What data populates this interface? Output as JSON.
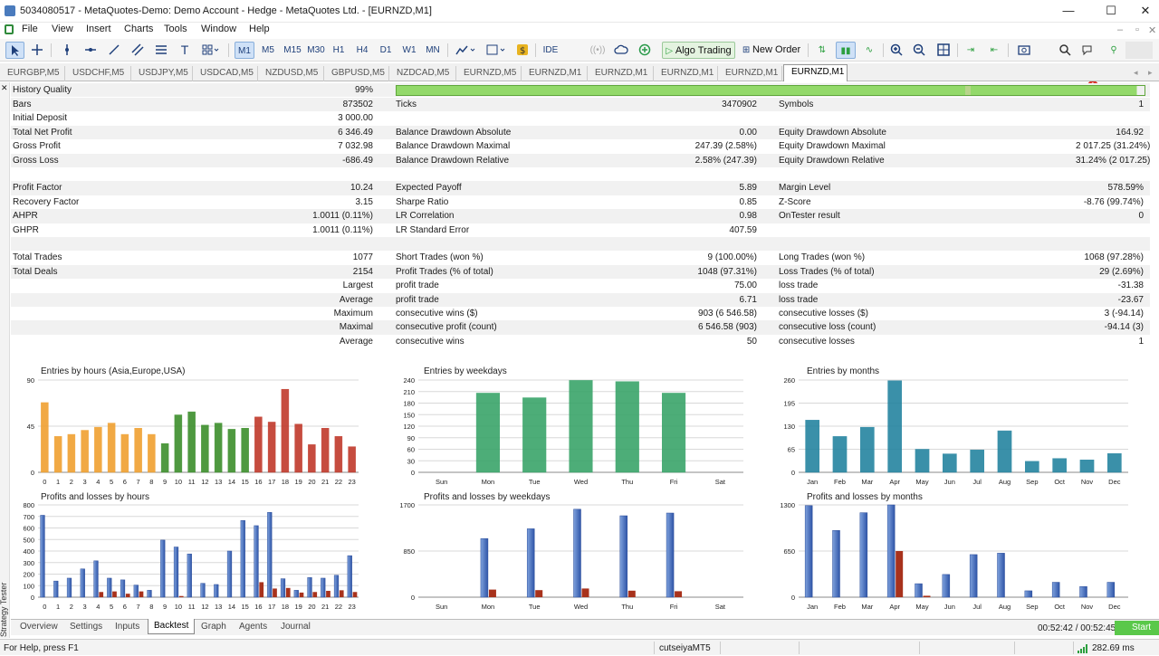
{
  "window": {
    "title": "5034080517 - MetaQuotes-Demo: Demo Account - Hedge - MetaQuotes Ltd. - [EURNZD,M1]",
    "minimize": "—",
    "maximize": "☐",
    "close": "✕"
  },
  "menu": [
    "File",
    "View",
    "Insert",
    "Charts",
    "Tools",
    "Window",
    "Help"
  ],
  "mdi_controls": [
    "–",
    "▫",
    "✕"
  ],
  "toolbar": {
    "timeframes": [
      "M1",
      "M5",
      "M15",
      "M30",
      "H1",
      "H4",
      "D1",
      "W1",
      "MN"
    ],
    "active_tf": "M1",
    "ide": "IDE",
    "algo_trading": "Algo Trading",
    "new_order": "New Order",
    "notification_badge": "1"
  },
  "chart_tabs": [
    "EURGBP,M5",
    "USDCHF,M5",
    "USDJPY,M5",
    "USDCAD,M5",
    "NZDUSD,M5",
    "GBPUSD,M5",
    "NZDCAD,M5",
    "EURNZD,M5",
    "EURNZD,M1",
    "EURNZD,M1",
    "EURNZD,M1",
    "EURNZD,M1",
    "EURNZD,M1"
  ],
  "tester_label": "Strategy Tester",
  "history_quality": {
    "label": "History Quality",
    "value": "99%",
    "fraction": 0.99
  },
  "stats": [
    {
      "l1": "Bars",
      "v1": "873502",
      "l2": "Ticks",
      "v2": "3470902",
      "l3": "Symbols",
      "v3": "1"
    },
    {
      "l1": "Initial Deposit",
      "v1": "3 000.00",
      "l2": "",
      "v2": "",
      "l3": "",
      "v3": ""
    },
    {
      "l1": "Total Net Profit",
      "v1": "6 346.49",
      "l2": "Balance Drawdown Absolute",
      "v2": "0.00",
      "l3": "Equity Drawdown Absolute",
      "v3": "164.92"
    },
    {
      "l1": "Gross Profit",
      "v1": "7 032.98",
      "l2": "Balance Drawdown Maximal",
      "v2": "247.39 (2.58%)",
      "l3": "Equity Drawdown Maximal",
      "v3": "2 017.25 (31.24%)"
    },
    {
      "l1": "Gross Loss",
      "v1": "-686.49",
      "l2": "Balance Drawdown Relative",
      "v2": "2.58% (247.39)",
      "l3": "Equity Drawdown Relative",
      "v3": "31.24% (2 017.25)"
    },
    {
      "l1": "",
      "v1": "",
      "l2": "",
      "v2": "",
      "l3": "",
      "v3": ""
    },
    {
      "l1": "Profit Factor",
      "v1": "10.24",
      "l2": "Expected Payoff",
      "v2": "5.89",
      "l3": "Margin Level",
      "v3": "578.59%"
    },
    {
      "l1": "Recovery Factor",
      "v1": "3.15",
      "l2": "Sharpe Ratio",
      "v2": "0.85",
      "l3": "Z-Score",
      "v3": "-8.76 (99.74%)"
    },
    {
      "l1": "AHPR",
      "v1": "1.0011 (0.11%)",
      "l2": "LR Correlation",
      "v2": "0.98",
      "l3": "OnTester result",
      "v3": "0"
    },
    {
      "l1": "GHPR",
      "v1": "1.0011 (0.11%)",
      "l2": "LR Standard Error",
      "v2": "407.59",
      "l3": "",
      "v3": ""
    },
    {
      "l1": "",
      "v1": "",
      "l2": "",
      "v2": "",
      "l3": "",
      "v3": ""
    },
    {
      "l1": "Total Trades",
      "v1": "1077",
      "l2": "Short Trades (won %)",
      "v2": "9 (100.00%)",
      "l3": "Long Trades (won %)",
      "v3": "1068 (97.28%)"
    },
    {
      "l1": "Total Deals",
      "v1": "2154",
      "l2": "Profit Trades (% of total)",
      "v2": "1048 (97.31%)",
      "l3": "Loss Trades (% of total)",
      "v3": "29 (2.69%)"
    },
    {
      "l1": "",
      "v1": "Largest",
      "l2": "profit trade",
      "v2": "75.00",
      "l3": "loss trade",
      "v3": "-31.38"
    },
    {
      "l1": "",
      "v1": "Average",
      "l2": "profit trade",
      "v2": "6.71",
      "l3": "loss trade",
      "v3": "-23.67"
    },
    {
      "l1": "",
      "v1": "Maximum",
      "l2": "consecutive wins ($)",
      "v2": "903 (6 546.58)",
      "l3": "consecutive losses ($)",
      "v3": "3 (-94.14)"
    },
    {
      "l1": "",
      "v1": "Maximal",
      "l2": "consecutive profit (count)",
      "v2": "6 546.58 (903)",
      "l3": "consecutive loss (count)",
      "v3": "-94.14 (3)"
    },
    {
      "l1": "",
      "v1": "Average",
      "l2": "consecutive wins",
      "v2": "50",
      "l3": "consecutive losses",
      "v3": "1"
    }
  ],
  "chart_data": [
    {
      "type": "bar",
      "title": "Entries by hours (Asia,Europe,USA)",
      "categories": [
        "0",
        "1",
        "2",
        "3",
        "4",
        "5",
        "6",
        "7",
        "8",
        "9",
        "10",
        "11",
        "12",
        "13",
        "14",
        "15",
        "16",
        "17",
        "18",
        "19",
        "20",
        "21",
        "22",
        "23"
      ],
      "values": [
        68,
        35,
        37,
        41,
        44,
        48,
        37,
        43,
        37,
        28,
        56,
        59,
        46,
        48,
        42,
        43,
        54,
        49,
        81,
        47,
        27,
        43,
        35,
        25,
        35
      ],
      "colors": [
        "#f0a030",
        "#f0a030",
        "#f0a030",
        "#f0a030",
        "#f0a030",
        "#f0a030",
        "#f0a030",
        "#f0a030",
        "#f0a030",
        "#3c8f2c",
        "#3c8f2c",
        "#3c8f2c",
        "#3c8f2c",
        "#3c8f2c",
        "#3c8f2c",
        "#3c8f2c",
        "#c0392b",
        "#c0392b",
        "#c0392b",
        "#c0392b",
        "#c0392b",
        "#c0392b",
        "#c0392b",
        "#c0392b"
      ],
      "yticks": [
        "0",
        "45",
        "90"
      ],
      "ylim": [
        0,
        90
      ]
    },
    {
      "type": "bar",
      "title": "Entries by weekdays",
      "categories": [
        "Sun",
        "Mon",
        "Tue",
        "Wed",
        "Thu",
        "Fri",
        "Sat"
      ],
      "values": [
        0,
        206,
        194,
        239,
        236,
        206,
        0
      ],
      "color": "#3aa56a",
      "yticks": [
        "0",
        "30",
        "60",
        "90",
        "120",
        "150",
        "180",
        "210",
        "240"
      ],
      "ylim": [
        0,
        240
      ]
    },
    {
      "type": "bar",
      "title": "Entries by months",
      "categories": [
        "Jan",
        "Feb",
        "Mar",
        "Apr",
        "May",
        "Jun",
        "Jul",
        "Aug",
        "Sep",
        "Oct",
        "Nov",
        "Dec"
      ],
      "values": [
        147,
        101,
        127,
        258,
        65,
        52,
        63,
        117,
        31,
        39,
        35,
        53
      ],
      "color": "#2584a0",
      "yticks": [
        "0",
        "65",
        "130",
        "195",
        "260"
      ],
      "ylim": [
        0,
        260
      ]
    },
    {
      "type": "bar",
      "title": "Profits and losses by hours",
      "categories": [
        "0",
        "1",
        "2",
        "3",
        "4",
        "5",
        "6",
        "7",
        "8",
        "9",
        "10",
        "11",
        "12",
        "13",
        "14",
        "15",
        "16",
        "17",
        "18",
        "19",
        "20",
        "21",
        "22",
        "23"
      ],
      "series": [
        {
          "name": "profit",
          "values": [
            710,
            140,
            165,
            245,
            315,
            165,
            150,
            105,
            60,
            495,
            435,
            375,
            120,
            110,
            400,
            665,
            620,
            735,
            160,
            60,
            170,
            165,
            190,
            360
          ]
        },
        {
          "name": "loss",
          "values": [
            0,
            0,
            0,
            0,
            45,
            50,
            30,
            50,
            0,
            0,
            10,
            0,
            0,
            0,
            0,
            0,
            130,
            75,
            80,
            40,
            45,
            55,
            60,
            45
          ]
        }
      ],
      "yticks": [
        "0",
        "100",
        "200",
        "300",
        "400",
        "500",
        "600",
        "700",
        "800"
      ],
      "ylim": [
        0,
        800
      ]
    },
    {
      "type": "bar",
      "title": "Profits and losses by weekdays",
      "categories": [
        "Sun",
        "Mon",
        "Tue",
        "Wed",
        "Thu",
        "Fri",
        "Sat"
      ],
      "series": [
        {
          "name": "profit",
          "values": [
            0,
            1080,
            1260,
            1620,
            1500,
            1550,
            0
          ]
        },
        {
          "name": "loss",
          "values": [
            0,
            140,
            130,
            160,
            120,
            110,
            0
          ]
        }
      ],
      "yticks": [
        "0",
        "850",
        "1700"
      ],
      "ylim": [
        0,
        1700
      ]
    },
    {
      "type": "bar",
      "title": "Profits and losses by months",
      "categories": [
        "Jan",
        "Feb",
        "Mar",
        "Apr",
        "May",
        "Jun",
        "Jul",
        "Aug",
        "Sep",
        "Oct",
        "Nov",
        "Dec"
      ],
      "series": [
        {
          "name": "profit",
          "values": [
            1290,
            940,
            1190,
            1300,
            190,
            320,
            600,
            620,
            90,
            210,
            150,
            210
          ]
        },
        {
          "name": "loss",
          "values": [
            0,
            0,
            0,
            650,
            20,
            0,
            0,
            0,
            0,
            0,
            0,
            0
          ]
        }
      ],
      "yticks": [
        "0",
        "650",
        "1300"
      ],
      "ylim": [
        0,
        1300
      ]
    }
  ],
  "bottom_tabs": [
    "Overview",
    "Settings",
    "Inputs",
    "Backtest",
    "Graph",
    "Agents",
    "Journal"
  ],
  "active_bottom_tab": "Backtest",
  "timer": "00:52:42 / 00:52:45",
  "start_button": "Start",
  "status": {
    "help": "For Help, press F1",
    "profile": "cutseiyaMT5",
    "ping": "282.69 ms"
  }
}
